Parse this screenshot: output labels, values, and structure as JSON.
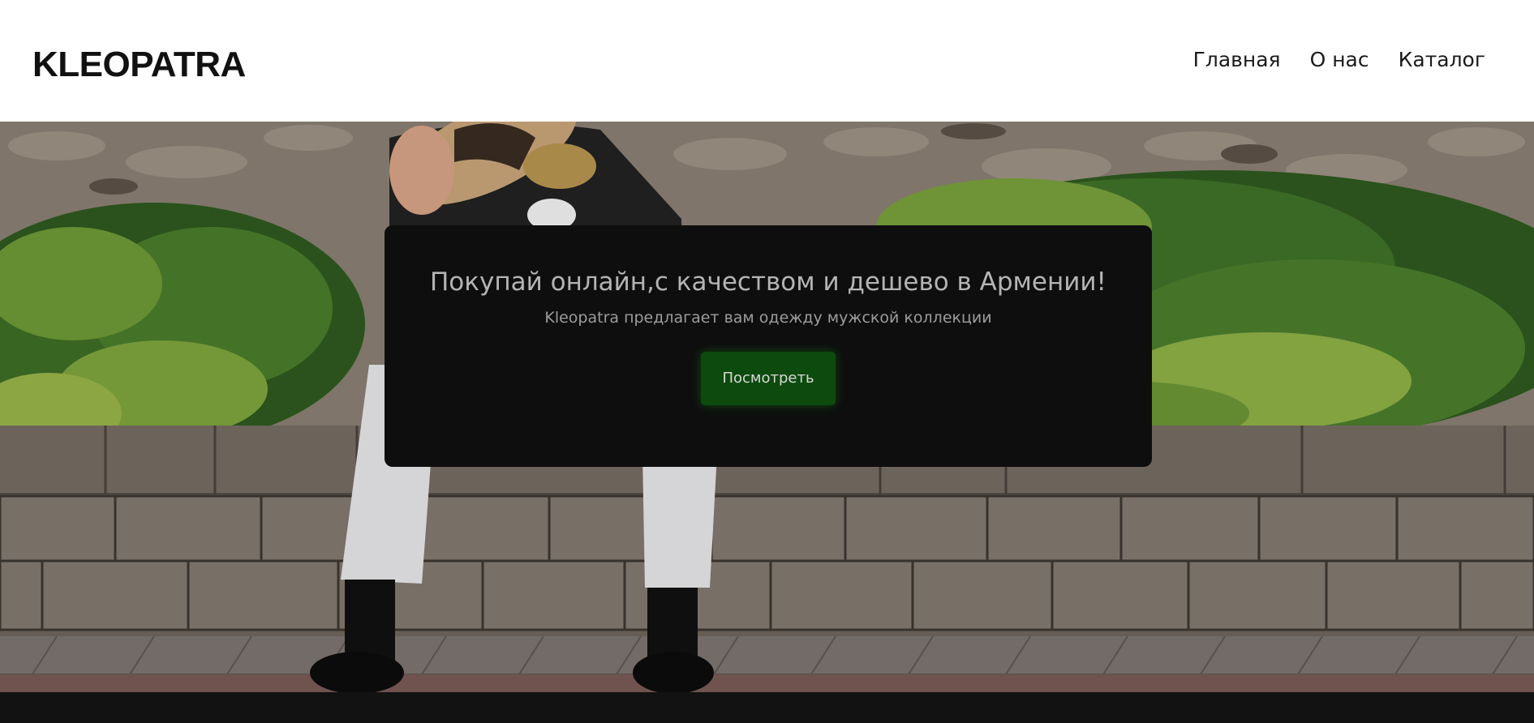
{
  "header": {
    "logo": "KLEOPATRA",
    "nav": [
      {
        "label": "Главная"
      },
      {
        "label": "О нас"
      },
      {
        "label": "Каталог"
      }
    ]
  },
  "hero": {
    "title": "Покупай онлайн,с качеством и дешево в Армении!",
    "subtitle": "Kleopatra предлагает вам одежду мужской коллекции",
    "button_label": "Посмотреть"
  },
  "colors": {
    "button": "#0d4a0d",
    "card": "#0e0e0e",
    "footer": "#121212"
  }
}
